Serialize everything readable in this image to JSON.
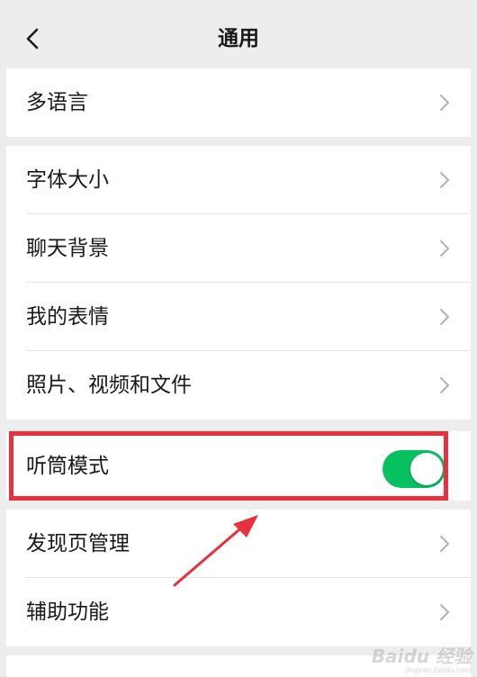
{
  "nav": {
    "title": "通用"
  },
  "groups": [
    {
      "items": [
        {
          "label": "多语言"
        }
      ]
    },
    {
      "items": [
        {
          "label": "字体大小"
        },
        {
          "label": "聊天背景"
        },
        {
          "label": "我的表情"
        },
        {
          "label": "照片、视频和文件"
        }
      ]
    },
    {
      "items": [
        {
          "label": "听筒模式",
          "toggle": true
        }
      ]
    },
    {
      "items": [
        {
          "label": "发现页管理"
        },
        {
          "label": "辅助功能"
        }
      ]
    }
  ],
  "earpiece_mode": {
    "on": true
  },
  "watermark": {
    "main": "Baidu 经验",
    "sub": "jingyan.baidu.com"
  },
  "colors": {
    "accent": "#07c160",
    "highlight": "#e8303f",
    "background": "#ededed"
  },
  "icons": {
    "back": "chevron-left-icon",
    "row": "chevron-right-icon"
  }
}
